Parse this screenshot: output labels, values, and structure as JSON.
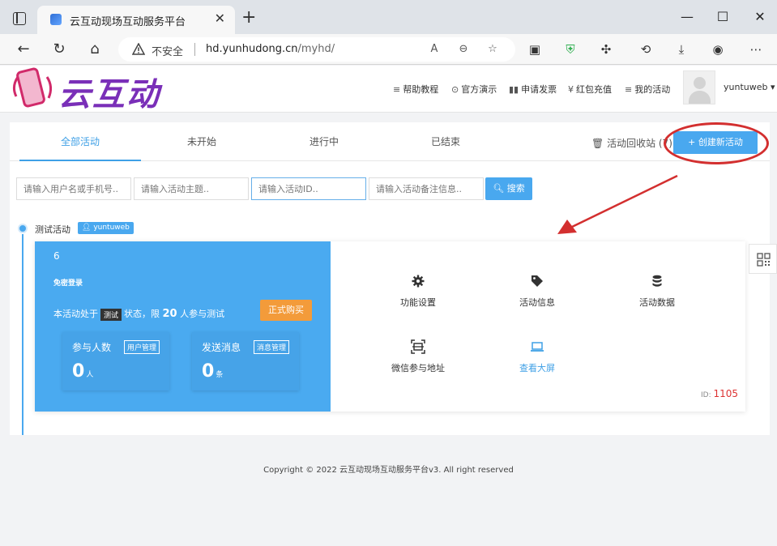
{
  "browser": {
    "tab_title": "云互动现场互动服务平台",
    "insecure_label": "不安全",
    "url_host": "hd.yunhudong.cn",
    "url_path": "/myhd/"
  },
  "header": {
    "logo_text": "云互动",
    "nav": [
      {
        "label": "帮助教程",
        "icon": "list-icon"
      },
      {
        "label": "官方演示",
        "icon": "play-circle-icon"
      },
      {
        "label": "申请发票",
        "icon": "columns-icon"
      },
      {
        "label": "红包充值",
        "icon": "yen-icon"
      },
      {
        "label": "我的活动",
        "icon": "list-icon"
      }
    ],
    "username": "yuntuweb"
  },
  "filter_tabs": [
    {
      "label": "全部活动",
      "active": true
    },
    {
      "label": "未开始",
      "active": false
    },
    {
      "label": "进行中",
      "active": false
    },
    {
      "label": "已结束",
      "active": false
    }
  ],
  "recycle_label": "活动回收站 (7)",
  "create_label": "+ 创建新活动",
  "search": {
    "user_placeholder": "请输入用户名或手机号..",
    "topic_placeholder": "请输入活动主题..",
    "id_placeholder": "请输入活动ID..",
    "note_placeholder": "请输入活动备注信息..",
    "button_label": "搜索"
  },
  "activity": {
    "title": "测试活动",
    "user_badge": "yuntuweb",
    "number": "6",
    "login_note": "免密登录",
    "status_prefix": "本活动处于",
    "status_badge": "测试",
    "status_mid": "状态，限",
    "limit": "20",
    "status_suffix": "人参与测试",
    "buy_label": "正式购买",
    "stats": [
      {
        "label": "参与人数",
        "tag": "用户管理",
        "value": "0",
        "unit": "人"
      },
      {
        "label": "发送消息",
        "tag": "消息管理",
        "value": "0",
        "unit": "条"
      }
    ],
    "functions": [
      {
        "label": "功能设置",
        "icon": "gear-icon"
      },
      {
        "label": "活动信息",
        "icon": "tag-icon"
      },
      {
        "label": "活动数据",
        "icon": "database-icon"
      },
      {
        "label": "微信参与地址",
        "icon": "scan-icon"
      },
      {
        "label": "查看大屏",
        "icon": "laptop-icon"
      }
    ],
    "id_label": "ID:",
    "id_value": "1105"
  },
  "footer": "Copyright © 2022 云互动现场互动服务平台v3. All right reserved",
  "colors": {
    "accent": "#49a8ef",
    "buy": "#f39b3a",
    "annotation": "#d32f2f",
    "logo": "#7a2fb8"
  }
}
